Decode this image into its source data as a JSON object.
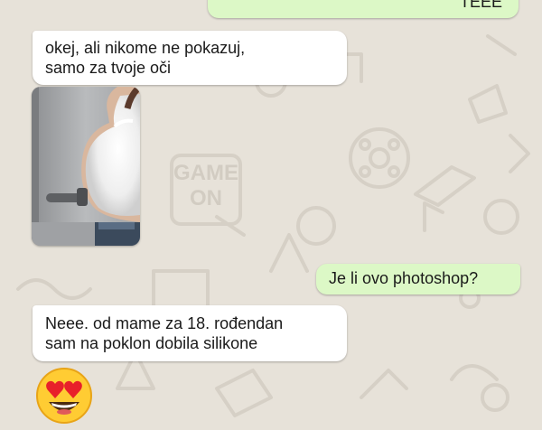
{
  "wallpaper": {
    "badge_line1": "GAME",
    "badge_line2": "ON"
  },
  "messages": [
    {
      "direction": "outgoing",
      "text": "TEEE"
    },
    {
      "direction": "incoming",
      "line1": "okej, ali nikome ne pokazuj,",
      "line2": "samo za tvoje oči"
    },
    {
      "direction": "incoming",
      "type": "photo"
    },
    {
      "direction": "outgoing",
      "text": "Je li ovo photoshop?"
    },
    {
      "direction": "incoming",
      "line1": "Neee. od mame za 18. rođendan",
      "line2": "sam na poklon dobila silikone"
    },
    {
      "direction": "incoming",
      "type": "emoji",
      "emoji": "heart-eyes-emoji"
    }
  ],
  "colors": {
    "outgoing_bubble": "#dcf8c6",
    "incoming_bubble": "#ffffff",
    "background": "#e7e2d9"
  }
}
